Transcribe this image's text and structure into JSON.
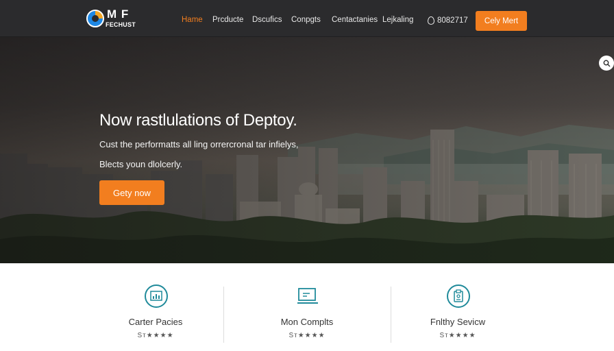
{
  "brand": {
    "logo_top": "M F",
    "logo_bottom": "FECHUST"
  },
  "nav": {
    "links": [
      {
        "label": "Hame",
        "active": true
      },
      {
        "label": "Prcducte",
        "active": false
      },
      {
        "label": "Dscufics",
        "active": false
      },
      {
        "label": "Conpgts",
        "active": false
      },
      {
        "label": "Centactanies",
        "active": false
      },
      {
        "label": "Lejkaling",
        "active": false
      }
    ],
    "phone": "8082717",
    "cta_label": "Cely Mert"
  },
  "hero": {
    "title": "Now rastlulations of Deptoy.",
    "subtitle_line1": "Cust the performatts all ling orrercronal tar infielys,",
    "subtitle_line2": "Blects youn dlolcerly.",
    "cta_label": "Gety now"
  },
  "features": [
    {
      "icon": "chart-icon",
      "title": "Carter Pacies",
      "rating": "Sт★★★★"
    },
    {
      "icon": "monitor-icon",
      "title": "Mon Complts",
      "rating": "Sт★★★★"
    },
    {
      "icon": "clipboard-icon",
      "title": "Fnlthy Sevicw",
      "rating": "Sт★★★★"
    }
  ],
  "colors": {
    "accent": "#f27e1f",
    "header_bg": "#2b2b2d",
    "icon_teal": "#1f8a9a"
  }
}
